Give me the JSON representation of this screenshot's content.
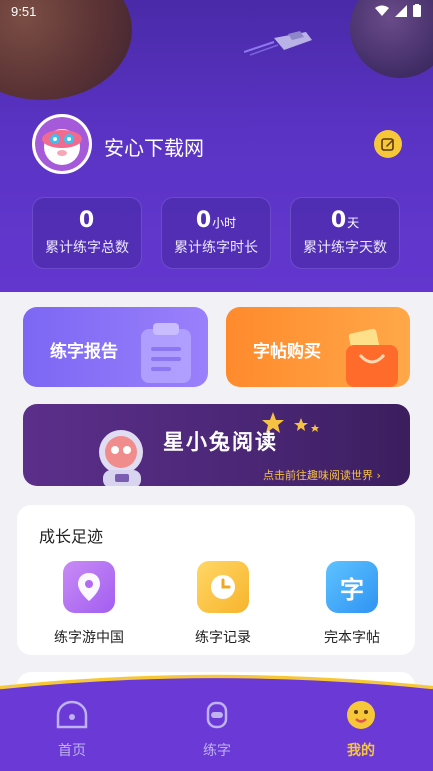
{
  "status_bar": {
    "time": "9:51"
  },
  "profile": {
    "username": "安心下载网"
  },
  "stats": [
    {
      "value": "0",
      "unit": "",
      "label": "累计练字总数"
    },
    {
      "value": "0",
      "unit": "小时",
      "label": "累计练字时长"
    },
    {
      "value": "0",
      "unit": "天",
      "label": "累计练字天数"
    }
  ],
  "cards": {
    "report_label": "练字报告",
    "buy_label": "字帖购买"
  },
  "banner": {
    "title": "星小兔阅读",
    "subtitle": "点击前往趣味阅读世界 ›"
  },
  "growth": {
    "title": "成长足迹",
    "items": [
      {
        "label": "练字游中国",
        "icon": "location-pin-icon"
      },
      {
        "label": "练字记录",
        "icon": "clock-icon"
      },
      {
        "label": "完本字帖",
        "icon": "character-icon",
        "glyph": "字"
      }
    ]
  },
  "tabbar": {
    "tabs": [
      {
        "label": "首页",
        "icon": "home-icon"
      },
      {
        "label": "练字",
        "icon": "practice-icon"
      },
      {
        "label": "我的",
        "icon": "smiley-icon"
      }
    ],
    "active_color": "#f7c73a",
    "inactive_color": "#bfb2f0"
  },
  "colors": {
    "header": "#5a33c4",
    "report": "#8b73f8",
    "buy": "#ff9a3d",
    "accent_yellow": "#f7c73a"
  }
}
